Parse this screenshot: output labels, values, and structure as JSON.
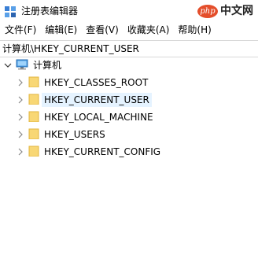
{
  "window": {
    "title": "注册表编辑器"
  },
  "watermark": {
    "badge": "php",
    "text": "中文网"
  },
  "menubar": {
    "items": [
      {
        "label": "文件(F)"
      },
      {
        "label": "编辑(E)"
      },
      {
        "label": "查看(V)"
      },
      {
        "label": "收藏夹(A)"
      },
      {
        "label": "帮助(H)"
      }
    ]
  },
  "address": {
    "path": "计算机\\HKEY_CURRENT_USER"
  },
  "tree": {
    "root": {
      "label": "计算机",
      "icon": "computer-icon",
      "expanded": true
    },
    "children": [
      {
        "label": "HKEY_CLASSES_ROOT",
        "icon": "folder-icon",
        "selected": false
      },
      {
        "label": "HKEY_CURRENT_USER",
        "icon": "folder-icon",
        "selected": true
      },
      {
        "label": "HKEY_LOCAL_MACHINE",
        "icon": "folder-icon",
        "selected": false
      },
      {
        "label": "HKEY_USERS",
        "icon": "folder-icon",
        "selected": false
      },
      {
        "label": "HKEY_CURRENT_CONFIG",
        "icon": "folder-icon",
        "selected": false
      }
    ]
  },
  "colors": {
    "selection": "#e5f3ff",
    "folder": "#f8d775",
    "watermark": "#e44e2b"
  }
}
